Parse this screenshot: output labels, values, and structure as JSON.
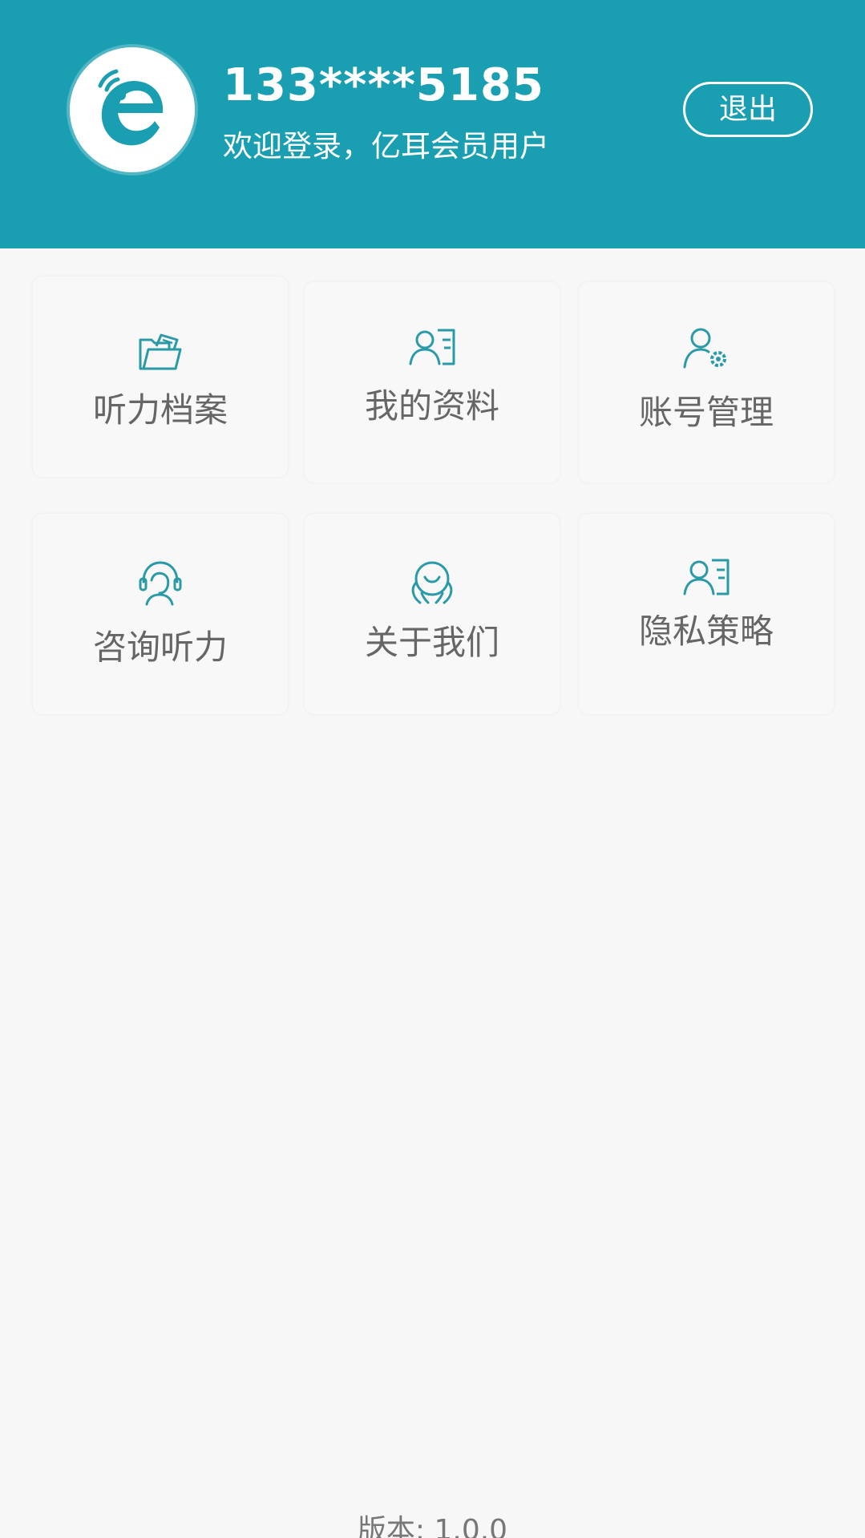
{
  "header": {
    "phone": "133****5185",
    "welcome": "欢迎登录，亿耳会员用户",
    "logout_label": "退出"
  },
  "menu": [
    {
      "label": "听力档案",
      "icon": "folder-icon"
    },
    {
      "label": "我的资料",
      "icon": "profile-card-icon"
    },
    {
      "label": "账号管理",
      "icon": "user-settings-icon"
    },
    {
      "label": "咨询听力",
      "icon": "headset-agent-icon"
    },
    {
      "label": "关于我们",
      "icon": "smile-face-icon"
    },
    {
      "label": "隐私策略",
      "icon": "profile-card-icon"
    }
  ],
  "footer": {
    "version": "版本: 1.0.0"
  },
  "colors": {
    "brand": "#1a9eb1",
    "icon": "#2a9aa8",
    "label": "#666666"
  }
}
